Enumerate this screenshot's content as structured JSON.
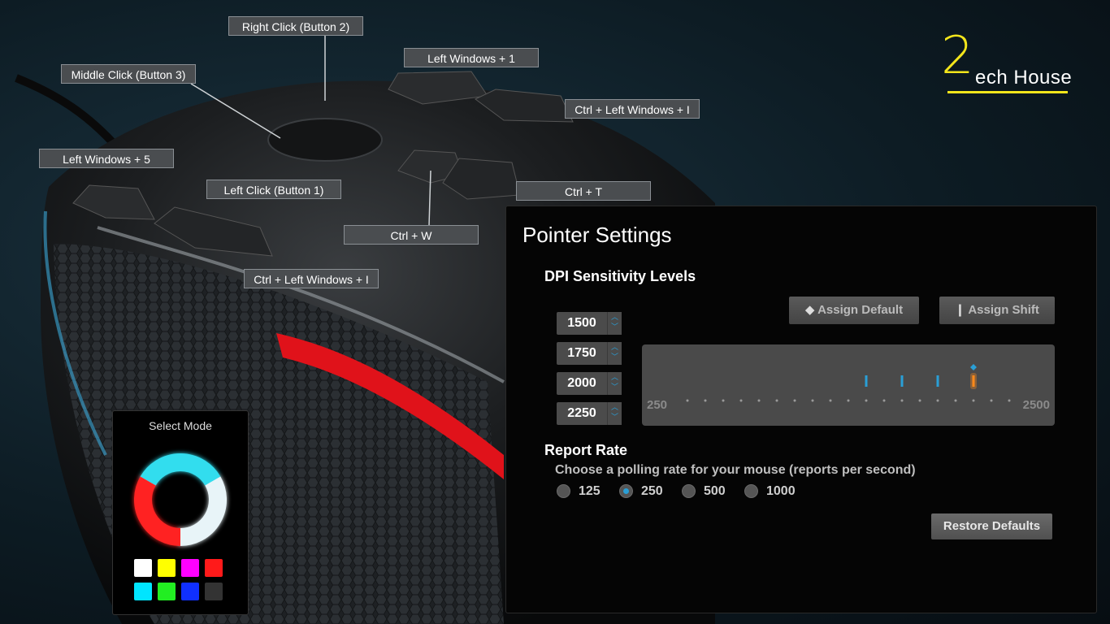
{
  "callouts": {
    "right_click": "Right Click (Button 2)",
    "middle_click": "Middle Click (Button 3)",
    "left_win_1": "Left Windows + 1",
    "ctrl_left_win_i_top": "Ctrl + Left Windows + I",
    "left_win_5": "Left Windows + 5",
    "left_click": "Left Click (Button 1)",
    "ctrl_t": "Ctrl + T",
    "ctrl_w": "Ctrl + W",
    "ctrl_left_win_i_bottom": "Ctrl + Left Windows + I"
  },
  "brand": {
    "numeral": "2",
    "name": "ech House",
    "accent": "#f3e51b"
  },
  "select_mode": {
    "title": "Select Mode",
    "ring_colors": [
      "#33ddee",
      "#ff2222",
      "#e8f4f8"
    ],
    "swatches": [
      "#ffffff",
      "#ffff00",
      "#ff00ff",
      "#ff1a1a",
      "#00e5ff",
      "#22ee22",
      "#1030ff",
      "#333333"
    ]
  },
  "pointer": {
    "title": "Pointer Settings",
    "dpi_title": "DPI Sensitivity Levels",
    "dpi_levels": [
      "1500",
      "1750",
      "2000",
      "2250"
    ],
    "assign_default": "Assign Default",
    "assign_shift": "Assign Shift",
    "slider_min": "250",
    "slider_max": "2500",
    "slider_markers": [
      1500,
      1750,
      2000
    ],
    "slider_active": 2250,
    "accent_blue": "#2a9fd6",
    "accent_orange": "#ff8a1a",
    "report_title": "Report Rate",
    "report_desc": "Choose a polling rate for your mouse (reports per second)",
    "rates": [
      "125",
      "250",
      "500",
      "1000"
    ],
    "selected_rate": "250",
    "restore": "Restore Defaults"
  }
}
